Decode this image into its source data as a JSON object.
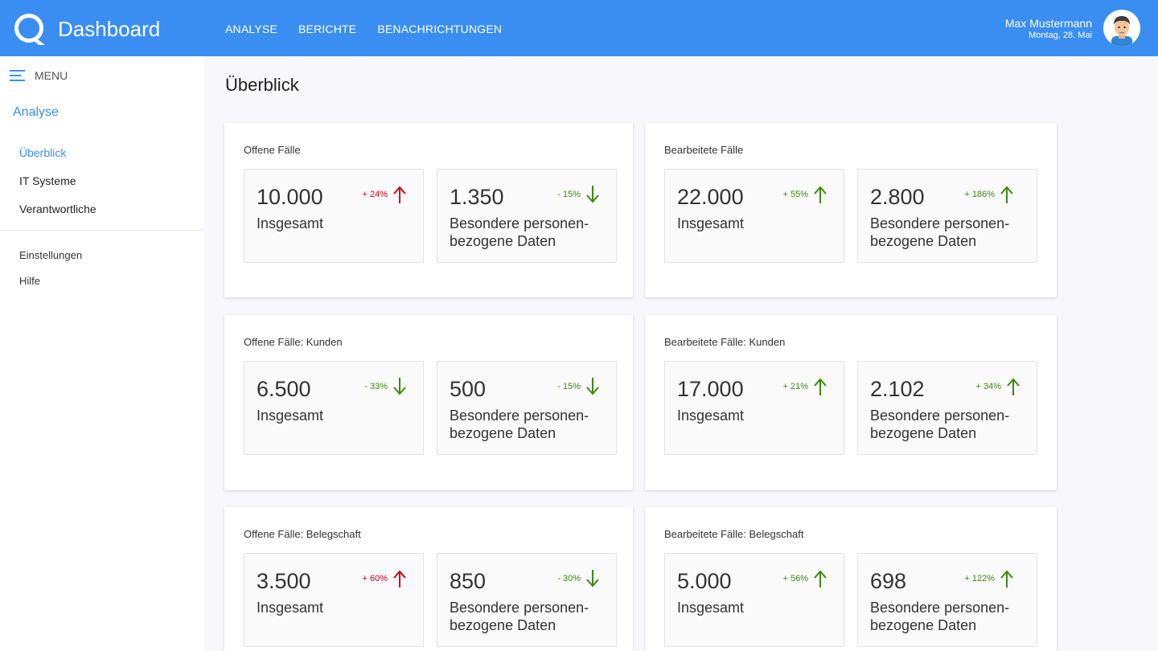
{
  "header": {
    "title": "Dashboard",
    "nav": [
      "ANALYSE",
      "BERICHTE",
      "BENACHRICHTUNGEN"
    ],
    "user_name": "Max Mustermann",
    "user_date": "Montag, 28. Mai"
  },
  "sidebar": {
    "menu_label": "MENU",
    "section_title": "Analyse",
    "items": [
      "Überblick",
      "IT Systeme",
      "Verantwortliche"
    ],
    "secondary": [
      "Einstellungen",
      "Hilfe"
    ]
  },
  "page": {
    "title": "Überblick"
  },
  "cards": [
    {
      "title": "Offene Fälle",
      "tiles": [
        {
          "value": "10.000",
          "label": "Insgesamt",
          "pct": "+ 24%",
          "direction": "up",
          "color": "red"
        },
        {
          "value": "1.350",
          "label": "Besondere personen-bezogene Daten",
          "pct": "- 15%",
          "direction": "down",
          "color": "green"
        }
      ]
    },
    {
      "title": "Bearbeitete Fälle",
      "tiles": [
        {
          "value": "22.000",
          "label": "Insgesamt",
          "pct": "+ 55%",
          "direction": "up",
          "color": "green"
        },
        {
          "value": "2.800",
          "label": "Besondere personen-bezogene Daten",
          "pct": "+ 186%",
          "direction": "up",
          "color": "green"
        }
      ]
    },
    {
      "title": "Offene Fälle: Kunden",
      "tiles": [
        {
          "value": "6.500",
          "label": "Insgesamt",
          "pct": "- 33%",
          "direction": "down",
          "color": "green"
        },
        {
          "value": "500",
          "label": "Besondere personen-bezogene Daten",
          "pct": "- 15%",
          "direction": "down",
          "color": "green"
        }
      ]
    },
    {
      "title": "Bearbeitete Fälle: Kunden",
      "tiles": [
        {
          "value": "17.000",
          "label": "Insgesamt",
          "pct": "+ 21%",
          "direction": "up",
          "color": "green"
        },
        {
          "value": "2.102",
          "label": "Besondere personen-bezogene Daten",
          "pct": "+ 34%",
          "direction": "up",
          "color": "green"
        }
      ]
    },
    {
      "title": "Offene Fälle: Belegschaft",
      "tiles": [
        {
          "value": "3.500",
          "label": "Insgesamt",
          "pct": "+ 60%",
          "direction": "up",
          "color": "red"
        },
        {
          "value": "850",
          "label": "Besondere personen-bezogene Daten",
          "pct": "- 30%",
          "direction": "down",
          "color": "green"
        }
      ]
    },
    {
      "title": "Bearbeitete Fälle: Belegschaft",
      "tiles": [
        {
          "value": "5.000",
          "label": "Insgesamt",
          "pct": "+ 56%",
          "direction": "up",
          "color": "green"
        },
        {
          "value": "698",
          "label": "Besondere personen-bezogene Daten",
          "pct": "+ 122%",
          "direction": "up",
          "color": "green"
        }
      ]
    }
  ],
  "colors": {
    "primary": "#3a8ef2",
    "trend_red": "#d0021b",
    "trend_green": "#3b8a0d"
  }
}
